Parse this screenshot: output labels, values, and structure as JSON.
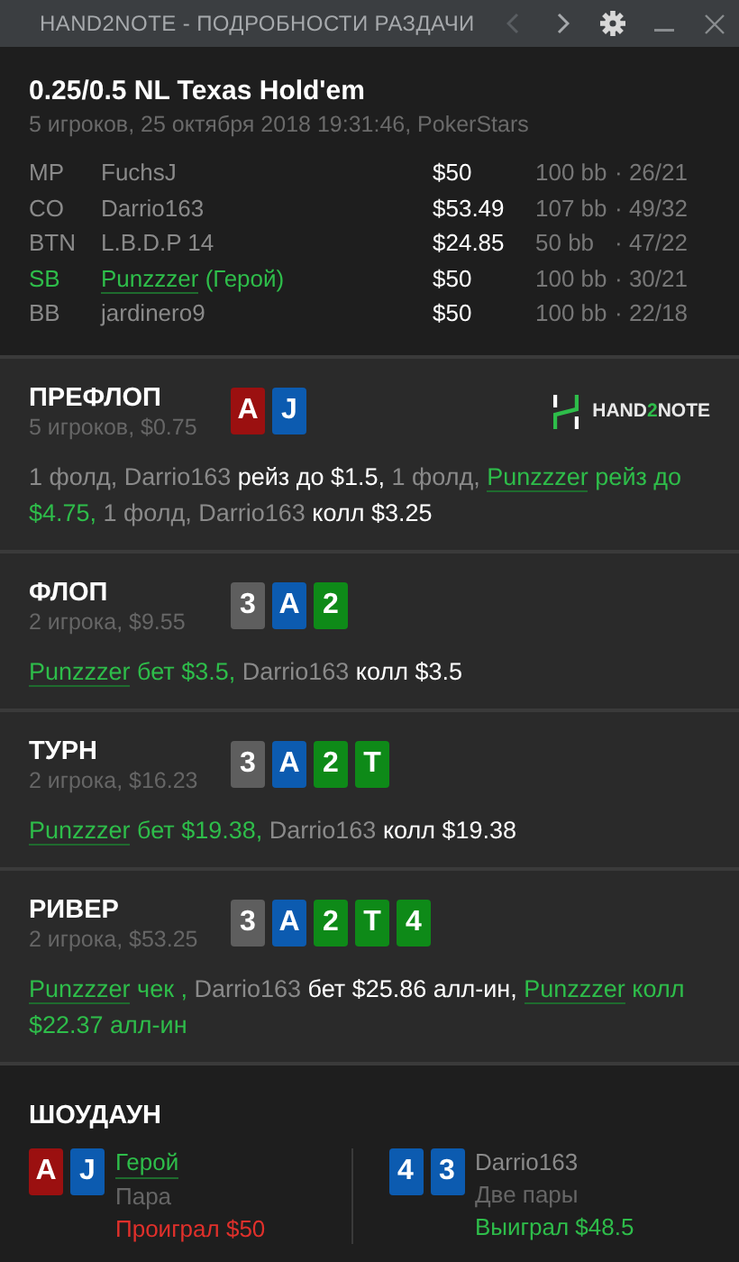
{
  "window": {
    "title": "HAND2NOTE - ПОДРОБНОСТИ РАЗДАЧИ",
    "nav": [
      {
        "kind": "back",
        "disabled": true
      },
      {
        "kind": "forward",
        "disabled": false
      }
    ]
  },
  "hand": {
    "title": "0.25/0.5 NL Texas Hold'em",
    "subtitle": "5 игроков, 25 октября 2018 19:31:46, PokerStars"
  },
  "players": [
    {
      "position": "MP",
      "name": "FuchsJ",
      "hero": false,
      "stack": "$50",
      "bb": "100 bb",
      "stats": "· 26/21"
    },
    {
      "position": "CO",
      "name": "Darrio163",
      "hero": false,
      "stack": "$53.49",
      "bb": "107 bb",
      "stats": "· 49/32"
    },
    {
      "position": "BTN",
      "name": "L.B.D.P 14",
      "hero": false,
      "stack": "$24.85",
      "bb": "50 bb",
      "stats": "· 47/22"
    },
    {
      "position": "SB",
      "name": "Punzzzer",
      "hero": true,
      "hero_label": " (Герой)",
      "stack": "$50",
      "bb": "100 bb",
      "stats": "· 30/21"
    },
    {
      "position": "BB",
      "name": "jardinero9",
      "hero": false,
      "stack": "$50",
      "bb": "100 bb",
      "stats": "· 22/18"
    }
  ],
  "logo": {
    "start": "HAND",
    "accent": "2",
    "end": "NOTE"
  },
  "streets": [
    {
      "name": "ПРЕФЛОП",
      "info": "5 игроков, $0.75",
      "logo": true,
      "cards": [
        {
          "rank": "A",
          "color": "#9b1010"
        },
        {
          "rank": "J",
          "color": "#0c5bb0"
        }
      ],
      "actions": [
        {
          "kind": "info",
          "text": "1 фолд, "
        },
        {
          "kind": "name",
          "text": "Darrio163"
        },
        {
          "kind": "action",
          "text": " рейз до $1.5, "
        },
        {
          "kind": "info",
          "text": "1 фолд, "
        },
        {
          "kind": "player",
          "text": "Punzzzer"
        },
        {
          "kind": "hero",
          "text": " рейз до $4.75, "
        },
        {
          "kind": "info",
          "text": "1 фолд, "
        },
        {
          "kind": "name",
          "text": "Darrio163"
        },
        {
          "kind": "action",
          "text": " колл $3.25"
        }
      ]
    },
    {
      "name": "ФЛОП",
      "info": "2 игрока, $9.55",
      "logo": false,
      "cards": [
        {
          "rank": "3",
          "color": "#5e5e5e"
        },
        {
          "rank": "A",
          "color": "#0c5bb0"
        },
        {
          "rank": "2",
          "color": "#0e8a18"
        }
      ],
      "actions": [
        {
          "kind": "player",
          "text": "Punzzzer"
        },
        {
          "kind": "hero",
          "text": " бет $3.5, "
        },
        {
          "kind": "name",
          "text": "Darrio163"
        },
        {
          "kind": "action",
          "text": " колл $3.5"
        }
      ]
    },
    {
      "name": "ТУРН",
      "info": "2 игрока, $16.23",
      "logo": false,
      "cards": [
        {
          "rank": "3",
          "color": "#5e5e5e"
        },
        {
          "rank": "A",
          "color": "#0c5bb0"
        },
        {
          "rank": "2",
          "color": "#0e8a18"
        },
        {
          "rank": "T",
          "color": "#0e8a18"
        }
      ],
      "actions": [
        {
          "kind": "player",
          "text": "Punzzzer"
        },
        {
          "kind": "hero",
          "text": " бет $19.38, "
        },
        {
          "kind": "name",
          "text": "Darrio163"
        },
        {
          "kind": "action",
          "text": " колл $19.38"
        }
      ]
    },
    {
      "name": "РИВЕР",
      "info": "2 игрока, $53.25",
      "logo": false,
      "cards": [
        {
          "rank": "3",
          "color": "#5e5e5e"
        },
        {
          "rank": "A",
          "color": "#0c5bb0"
        },
        {
          "rank": "2",
          "color": "#0e8a18"
        },
        {
          "rank": "T",
          "color": "#0e8a18"
        },
        {
          "rank": "4",
          "color": "#0e8a18"
        }
      ],
      "actions": [
        {
          "kind": "player",
          "text": "Punzzzer"
        },
        {
          "kind": "hero",
          "text": " чек , "
        },
        {
          "kind": "name",
          "text": "Darrio163"
        },
        {
          "kind": "action",
          "text": " бет $25.86 алл-ин, "
        },
        {
          "kind": "player",
          "text": "Punzzzer"
        },
        {
          "kind": "hero",
          "text": " колл $22.37 алл-ин"
        }
      ]
    }
  ],
  "showdown": {
    "title": "ШОУДАУН",
    "hands": [
      {
        "name": "Герой",
        "hero": true,
        "hand": "Пара",
        "result": "Проиграл $50",
        "won": false,
        "cards": [
          {
            "rank": "A",
            "color": "#9b1010"
          },
          {
            "rank": "J",
            "color": "#0c5bb0"
          }
        ]
      },
      {
        "name": "Darrio163",
        "hero": false,
        "hand": "Две пары",
        "result": "Выиграл $48.5",
        "won": true,
        "cards": [
          {
            "rank": "4",
            "color": "#0c5bb0"
          },
          {
            "rank": "3",
            "color": "#0c5bb0"
          }
        ]
      }
    ]
  }
}
